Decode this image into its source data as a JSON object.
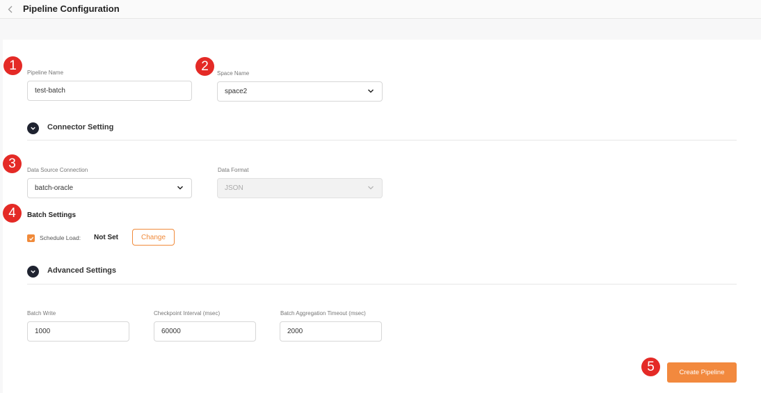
{
  "header": {
    "title": "Pipeline Configuration",
    "back_icon": "chevron-left-icon"
  },
  "badges": [
    "1",
    "2",
    "3",
    "4",
    "5"
  ],
  "pipeline_name": {
    "label": "Pipeline Name",
    "value": "test-batch"
  },
  "space_name": {
    "label": "Space Name",
    "value": "space2"
  },
  "connector_setting": {
    "title": "Connector Setting"
  },
  "data_source": {
    "label": "Data Source Connection",
    "value": "batch-oracle"
  },
  "data_format": {
    "label": "Data Format",
    "value": "JSON",
    "disabled": true
  },
  "batch_settings": {
    "title": "Batch Settings",
    "schedule_label": "Schedule Load:",
    "schedule_checked": true,
    "schedule_value": "Not Set",
    "change_label": "Change"
  },
  "advanced_settings": {
    "title": "Advanced Settings",
    "batch_write": {
      "label": "Batch Write",
      "value": "1000"
    },
    "checkpoint_interval": {
      "label": "Checkpoint Interval (msec)",
      "value": "60000"
    },
    "batch_aggregation_timeout": {
      "label": "Batch Aggregation Timeout (msec)",
      "value": "2000"
    }
  },
  "actions": {
    "create_label": "Create Pipeline"
  },
  "colors": {
    "accent": "#f2893e",
    "badge": "#e42a26",
    "section_icon": "#1f2330"
  }
}
